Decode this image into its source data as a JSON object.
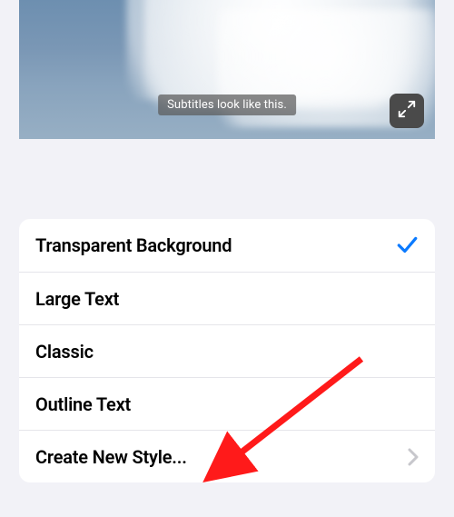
{
  "preview": {
    "subtitle_text": "Subtitles look like this."
  },
  "styles": {
    "items": [
      {
        "label": "Transparent Background",
        "selected": true
      },
      {
        "label": "Large Text",
        "selected": false
      },
      {
        "label": "Classic",
        "selected": false
      },
      {
        "label": "Outline Text",
        "selected": false
      }
    ],
    "create_label": "Create New Style..."
  }
}
